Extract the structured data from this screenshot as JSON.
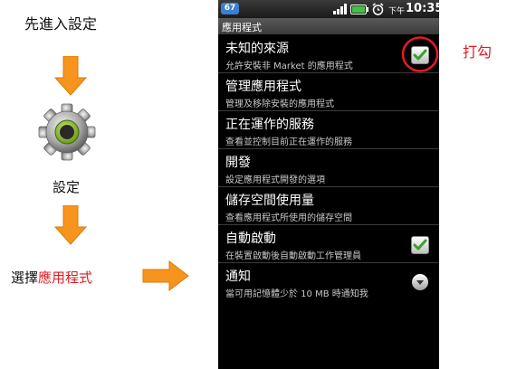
{
  "annotations": {
    "step1": "先進入設定",
    "settings_label": "設定",
    "choose_prefix": "選擇",
    "choose_highlight": "應用程式",
    "tick_label": "打勾"
  },
  "status_bar": {
    "badge": "67",
    "time_prefix": "下午",
    "time": "10:35"
  },
  "screen_title": "應用程式",
  "settings": [
    {
      "title": "未知的來源",
      "subtitle": "允許安裝非 Market 的應用程式",
      "control": "checkbox",
      "checked": true
    },
    {
      "title": "管理應用程式",
      "subtitle": "管理及移除安裝的應用程式"
    },
    {
      "title": "正在運作的服務",
      "subtitle": "查看並控制目前正在運作的服務"
    },
    {
      "title": "開發",
      "subtitle": "設定應用程式開發的選項"
    },
    {
      "title": "儲存空間使用量",
      "subtitle": "查看應用程式所使用的儲存空間"
    },
    {
      "title": "自動啟動",
      "subtitle": "在裝置啟動後自動啟動工作管理員",
      "control": "checkbox",
      "checked": true
    },
    {
      "title": "通知",
      "subtitle": "當可用記憶體少於 10 MB 時通知我",
      "control": "dropdown"
    }
  ],
  "colors": {
    "arrow": "#f7941d",
    "highlight_text": "#e31b23",
    "circle": "#e31b23",
    "check": "#3aa02f"
  },
  "icons": [
    "gear-icon",
    "signal-icon",
    "battery-icon",
    "alarm-icon",
    "checkmark-icon",
    "chevron-down-icon"
  ]
}
